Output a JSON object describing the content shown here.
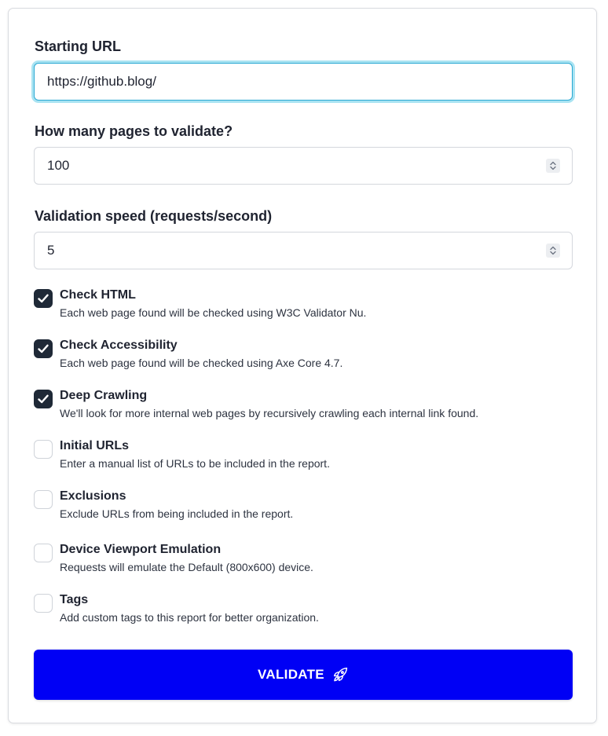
{
  "form": {
    "starting_url": {
      "label": "Starting URL",
      "value": "https://github.blog/"
    },
    "pages": {
      "label": "How many pages to validate?",
      "value": "100"
    },
    "speed": {
      "label": "Validation speed (requests/second)",
      "value": "5"
    },
    "options": [
      {
        "title": "Check HTML",
        "description": "Each web page found will be checked using W3C Validator Nu.",
        "checked": true
      },
      {
        "title": "Check Accessibility",
        "description": "Each web page found will be checked using Axe Core 4.7.",
        "checked": true
      },
      {
        "title": "Deep Crawling",
        "description": "We'll look for more internal web pages by recursively crawling each internal link found.",
        "checked": true
      },
      {
        "title": "Initial URLs",
        "description": "Enter a manual list of URLs to be included in the report.",
        "checked": false
      },
      {
        "title": "Exclusions",
        "description": "Exclude URLs from being included in the report.",
        "checked": false
      },
      {
        "title": "Device Viewport Emulation",
        "description": "Requests will emulate the Default (800x600) device.",
        "checked": false
      },
      {
        "title": "Tags",
        "description": "Add custom tags to this report for better organization.",
        "checked": false
      }
    ],
    "submit": {
      "label": "VALIDATE",
      "icon": "rocket-icon"
    }
  },
  "colors": {
    "accent": "#0000f5",
    "checkbox_checked": "#1f2937",
    "focus_ring": "#29a8d3"
  }
}
